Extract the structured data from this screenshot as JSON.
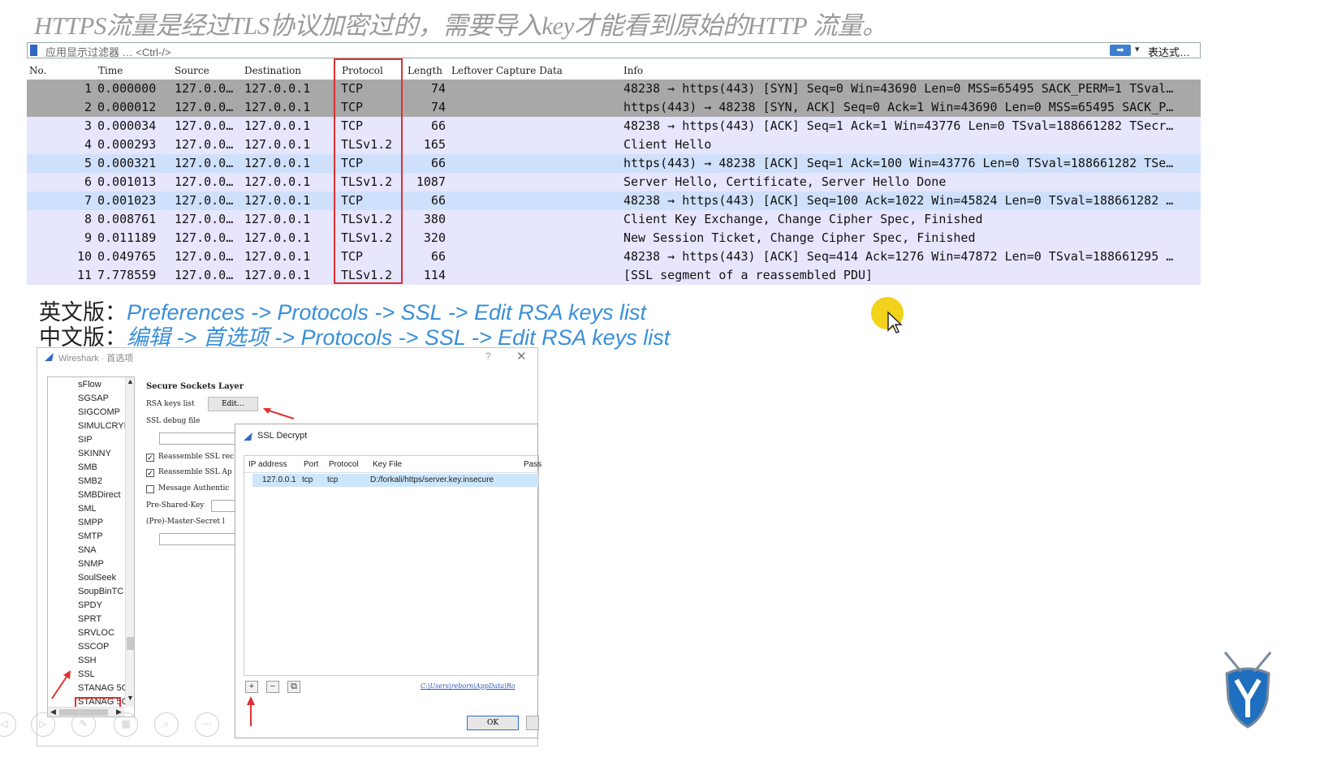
{
  "heading": "HTTPS流量是经过TLS协议加密过的，需要导入key才能看到原始的HTTP 流量。",
  "filter": {
    "placeholder": "应用显示过滤器 … <Ctrl-/>",
    "expression_label": "表达式…",
    "apply_icon": "arrow-right-icon",
    "dropdown_icon": "chevron-down-icon"
  },
  "packet_list": {
    "columns": [
      "No.",
      "Time",
      "Source",
      "Destination",
      "Protocol",
      "Length",
      "Leftover Capture Data",
      "Info"
    ],
    "rows": [
      {
        "no": "1",
        "time": "0.000000",
        "src": "127.0.0…",
        "dst": "127.0.0.1",
        "proto": "TCP",
        "len": "74",
        "info": "48238 → https(443) [SYN] Seq=0 Win=43690 Len=0 MSS=65495 SACK_PERM=1 TSval…"
      },
      {
        "no": "2",
        "time": "0.000012",
        "src": "127.0.0…",
        "dst": "127.0.0.1",
        "proto": "TCP",
        "len": "74",
        "info": "https(443) → 48238 [SYN, ACK] Seq=0 Ack=1 Win=43690 Len=0 MSS=65495 SACK_P…"
      },
      {
        "no": "3",
        "time": "0.000034",
        "src": "127.0.0…",
        "dst": "127.0.0.1",
        "proto": "TCP",
        "len": "66",
        "info": "48238 → https(443) [ACK] Seq=1 Ack=1 Win=43776 Len=0 TSval=188661282 TSecr…"
      },
      {
        "no": "4",
        "time": "0.000293",
        "src": "127.0.0…",
        "dst": "127.0.0.1",
        "proto": "TLSv1.2",
        "len": "165",
        "info": "Client Hello"
      },
      {
        "no": "5",
        "time": "0.000321",
        "src": "127.0.0…",
        "dst": "127.0.0.1",
        "proto": "TCP",
        "len": "66",
        "info": "https(443) → 48238 [ACK] Seq=1 Ack=100 Win=43776 Len=0 TSval=188661282 TSe…"
      },
      {
        "no": "6",
        "time": "0.001013",
        "src": "127.0.0…",
        "dst": "127.0.0.1",
        "proto": "TLSv1.2",
        "len": "1087",
        "info": "Server Hello, Certificate, Server Hello Done"
      },
      {
        "no": "7",
        "time": "0.001023",
        "src": "127.0.0…",
        "dst": "127.0.0.1",
        "proto": "TCP",
        "len": "66",
        "info": "48238 → https(443) [ACK] Seq=100 Ack=1022 Win=45824 Len=0 TSval=188661282 …"
      },
      {
        "no": "8",
        "time": "0.008761",
        "src": "127.0.0…",
        "dst": "127.0.0.1",
        "proto": "TLSv1.2",
        "len": "380",
        "info": "Client Key Exchange, Change Cipher Spec, Finished"
      },
      {
        "no": "9",
        "time": "0.011189",
        "src": "127.0.0…",
        "dst": "127.0.0.1",
        "proto": "TLSv1.2",
        "len": "320",
        "info": "New Session Ticket, Change Cipher Spec, Finished"
      },
      {
        "no": "10",
        "time": "0.049765",
        "src": "127.0.0…",
        "dst": "127.0.0.1",
        "proto": "TCP",
        "len": "66",
        "info": "48238 → https(443) [ACK] Seq=414 Ack=1276 Win=47872 Len=0 TSval=188661295 …"
      },
      {
        "no": "11",
        "time": "7.778559",
        "src": "127.0.0…",
        "dst": "127.0.0.1",
        "proto": "TLSv1.2",
        "len": "114",
        "info": "[SSL segment of a reassembled PDU]"
      }
    ]
  },
  "instructions": {
    "english_label": "英文版：",
    "english_path": "Preferences -> Protocols -> SSL -> Edit RSA keys list",
    "chinese_label": "中文版：",
    "chinese_path": "编辑 -> 首选项 -> Protocols -> SSL -> Edit RSA keys list"
  },
  "prefs_dialog": {
    "title": "Wireshark · 首选项",
    "help": "?",
    "close": "✕",
    "tree_items": [
      "sFlow",
      "SGSAP",
      "SIGCOMP",
      "SIMULCRYI",
      "SIP",
      "SKINNY",
      "SMB",
      "SMB2",
      "SMBDirect",
      "SML",
      "SMPP",
      "SMTP",
      "SNA",
      "SNMP",
      "SoulSeek",
      "SoupBinTC",
      "SPDY",
      "SPRT",
      "SRVLOC",
      "SSCOP",
      "SSH",
      "SSL",
      "STANAG 5C",
      "STANAG 5C"
    ],
    "selected_item": "SSL",
    "section_title": "Secure Sockets Layer",
    "rsa_label": "RSA keys list",
    "edit_button": "Edit…",
    "debug_label": "SSL debug file",
    "chk_reassemble_records": "Reassemble SSL rec",
    "chk_reassemble_app": "Reassemble SSL Ap",
    "chk_mac": "Message Authentic",
    "psk_label": "Pre-Shared-Key",
    "master_label": "(Pre)-Master-Secret l"
  },
  "ssl_dialog": {
    "title": "SSL Decrypt",
    "columns": [
      "IP address",
      "Port",
      "Protocol",
      "Key File",
      "Pass"
    ],
    "row": {
      "ip": "127.0.0.1",
      "port": "tcp",
      "protocol": "tcp",
      "keyfile": "D:/forkali/https/server.key.insecure"
    },
    "add_button": "+",
    "remove_button": "−",
    "copy_button": "⧉",
    "path_link": "C:\\Users\\reborn\\AppData\\Ro",
    "ok_button": "OK"
  },
  "colors": {
    "row_gray": "#a8a8a8",
    "row_lavender": "#e7e6ff",
    "row_blue": "#cfe0fb",
    "accent": "#3a8fd8",
    "annotation_red": "#e03030"
  },
  "icons": [
    "shark-fin-icon",
    "cursor-icon",
    "shield-logo-icon"
  ]
}
